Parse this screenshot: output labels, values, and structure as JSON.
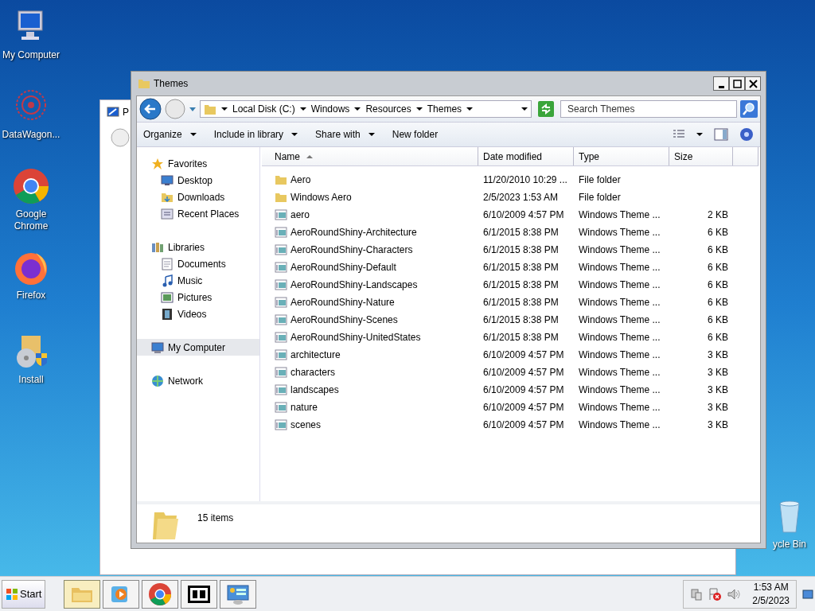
{
  "desktop_icons": [
    {
      "label": "My Computer",
      "kind": "computer"
    },
    {
      "label": "DataWagon...",
      "kind": "flower"
    },
    {
      "label": "Google Chrome",
      "kind": "chrome"
    },
    {
      "label": "Firefox",
      "kind": "firefox"
    },
    {
      "label": "Install",
      "kind": "install"
    },
    {
      "label": "ycle Bin",
      "kind": "bin"
    }
  ],
  "background_window": {
    "title": "P"
  },
  "explorer": {
    "title": "Themes",
    "breadcrumb": [
      "Local Disk (C:)",
      "Windows",
      "Resources",
      "Themes"
    ],
    "search": {
      "placeholder": "Search Themes"
    },
    "commands": [
      {
        "label": "Organize",
        "dropdown": true
      },
      {
        "label": "Include in library",
        "dropdown": true
      },
      {
        "label": "Share with",
        "dropdown": true
      },
      {
        "label": "New folder",
        "dropdown": false
      }
    ],
    "nav": [
      {
        "label": "Favorites",
        "kind": "star",
        "selected": false,
        "children": [
          {
            "label": "Desktop",
            "kind": "desktop",
            "selected": false
          },
          {
            "label": "Downloads",
            "kind": "folder",
            "selected": false
          },
          {
            "label": "Recent Places",
            "kind": "recent",
            "selected": false
          }
        ]
      },
      {
        "label": "Libraries",
        "kind": "library",
        "selected": false,
        "children": [
          {
            "label": "Documents",
            "kind": "document",
            "selected": false
          },
          {
            "label": "Music",
            "kind": "music",
            "selected": false
          },
          {
            "label": "Pictures",
            "kind": "picture",
            "selected": false
          },
          {
            "label": "Videos",
            "kind": "video",
            "selected": false
          }
        ]
      },
      {
        "label": "My Computer",
        "kind": "computer",
        "selected": true
      },
      {
        "label": "Network",
        "kind": "network",
        "selected": false
      }
    ],
    "columns": [
      "Name",
      "Date modified",
      "Type",
      "Size"
    ],
    "rows": [
      {
        "kind": "folder",
        "name": "Aero",
        "date": "11/20/2010 10:29 ...",
        "type": "File folder"
      },
      {
        "kind": "folder",
        "name": "Windows Aero",
        "date": "2/5/2023 1:53 AM",
        "type": "File folder"
      },
      {
        "kind": "theme",
        "name": "aero",
        "date": "6/10/2009 4:57 PM",
        "type": "Windows Theme ...",
        "size": "2 KB"
      },
      {
        "kind": "theme",
        "name": "AeroRoundShiny-Architecture",
        "date": "6/1/2015 8:38 PM",
        "type": "Windows Theme ...",
        "size": "6 KB"
      },
      {
        "kind": "theme",
        "name": "AeroRoundShiny-Characters",
        "date": "6/1/2015 8:38 PM",
        "type": "Windows Theme ...",
        "size": "6 KB"
      },
      {
        "kind": "theme",
        "name": "AeroRoundShiny-Default",
        "date": "6/1/2015 8:38 PM",
        "type": "Windows Theme ...",
        "size": "6 KB"
      },
      {
        "kind": "theme",
        "name": "AeroRoundShiny-Landscapes",
        "date": "6/1/2015 8:38 PM",
        "type": "Windows Theme ...",
        "size": "6 KB"
      },
      {
        "kind": "theme",
        "name": "AeroRoundShiny-Nature",
        "date": "6/1/2015 8:38 PM",
        "type": "Windows Theme ...",
        "size": "6 KB"
      },
      {
        "kind": "theme",
        "name": "AeroRoundShiny-Scenes",
        "date": "6/1/2015 8:38 PM",
        "type": "Windows Theme ...",
        "size": "6 KB"
      },
      {
        "kind": "theme",
        "name": "AeroRoundShiny-UnitedStates",
        "date": "6/1/2015 8:38 PM",
        "type": "Windows Theme ...",
        "size": "6 KB"
      },
      {
        "kind": "theme",
        "name": "architecture",
        "date": "6/10/2009 4:57 PM",
        "type": "Windows Theme ...",
        "size": "3 KB"
      },
      {
        "kind": "theme",
        "name": "characters",
        "date": "6/10/2009 4:57 PM",
        "type": "Windows Theme ...",
        "size": "3 KB"
      },
      {
        "kind": "theme",
        "name": "landscapes",
        "date": "6/10/2009 4:57 PM",
        "type": "Windows Theme ...",
        "size": "3 KB"
      },
      {
        "kind": "theme",
        "name": "nature",
        "date": "6/10/2009 4:57 PM",
        "type": "Windows Theme ...",
        "size": "3 KB"
      },
      {
        "kind": "theme",
        "name": "scenes",
        "date": "6/10/2009 4:57 PM",
        "type": "Windows Theme ...",
        "size": "3 KB"
      }
    ],
    "status": "15 items"
  },
  "taskbar": {
    "start": "Start",
    "apps": [
      {
        "kind": "explorer",
        "selected": true
      },
      {
        "kind": "media",
        "selected": false
      },
      {
        "kind": "chrome",
        "selected": false
      },
      {
        "kind": "sevenzip",
        "selected": false
      },
      {
        "kind": "panel",
        "selected": false
      }
    ],
    "time": "1:53 AM",
    "date": "2/5/2023"
  }
}
